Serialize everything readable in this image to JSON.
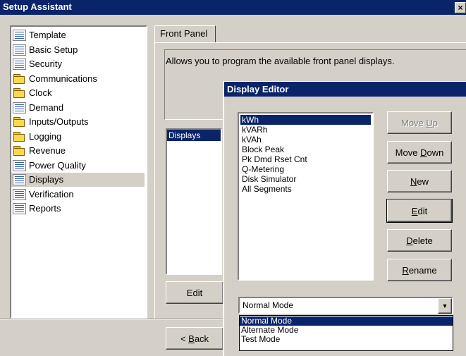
{
  "window": {
    "title": "Setup Assistant",
    "close_glyph": "×"
  },
  "tree": {
    "items": [
      {
        "label": "Template",
        "icon": "document-icon"
      },
      {
        "label": "Basic Setup",
        "icon": "document-icon"
      },
      {
        "label": "Security",
        "icon": "document-icon"
      },
      {
        "label": "Communications",
        "icon": "folder-icon"
      },
      {
        "label": "Clock",
        "icon": "folder-icon"
      },
      {
        "label": "Demand",
        "icon": "document-icon"
      },
      {
        "label": "Inputs/Outputs",
        "icon": "folder-icon"
      },
      {
        "label": "Logging",
        "icon": "folder-icon"
      },
      {
        "label": "Revenue",
        "icon": "folder-icon"
      },
      {
        "label": "Power Quality",
        "icon": "document-icon"
      },
      {
        "label": "Displays",
        "icon": "document-icon",
        "selected": true
      },
      {
        "label": "Verification",
        "icon": "document-icon"
      },
      {
        "label": "Reports",
        "icon": "document-icon"
      }
    ]
  },
  "main": {
    "tab_label": "Front Panel",
    "description": "Allows you to program the available front panel displays.",
    "list_header": "Displays",
    "edit_label": "Edit"
  },
  "nav": {
    "back_label": "< Back",
    "back_mnemonic": "B"
  },
  "dialog": {
    "title": "Display Editor",
    "items": [
      "kWh",
      "kVARh",
      "kVAh",
      "Block Peak",
      "Pk Dmd Rset Cnt",
      "Q-Metering",
      "Disk Simulator",
      "All Segments"
    ],
    "selected_index": 0,
    "buttons": {
      "move_up": {
        "pre": "Move ",
        "mn": "U",
        "post": "p"
      },
      "move_down": {
        "pre": "Move ",
        "mn": "D",
        "post": "own"
      },
      "new": {
        "pre": "",
        "mn": "N",
        "post": "ew"
      },
      "edit": {
        "pre": "",
        "mn": "E",
        "post": "dit"
      },
      "delete": {
        "pre": "",
        "mn": "D",
        "post": "elete"
      },
      "rename": {
        "pre": "",
        "mn": "R",
        "post": "ename"
      }
    },
    "mode_select": {
      "value": "Normal Mode",
      "options": [
        "Normal Mode",
        "Alternate Mode",
        "Test Mode"
      ]
    }
  },
  "colors": {
    "titlebar": "#0a246a",
    "face": "#d4d0c8",
    "selection": "#0a246a"
  }
}
